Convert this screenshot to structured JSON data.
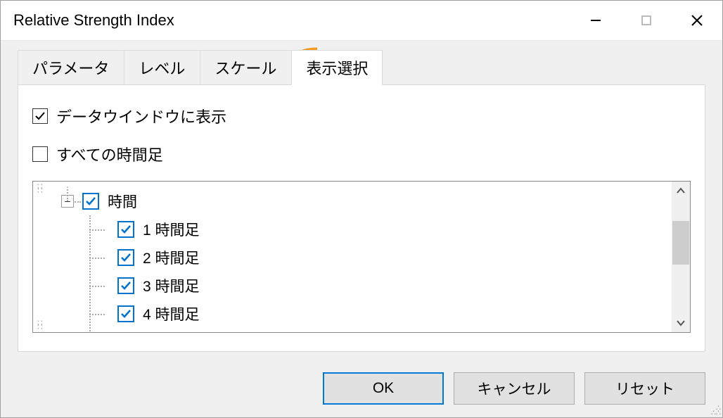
{
  "title": "Relative Strength Index",
  "tabs": [
    {
      "label": "パラメータ"
    },
    {
      "label": "レベル"
    },
    {
      "label": "スケール"
    },
    {
      "label": "表示選択"
    }
  ],
  "active_tab": 3,
  "options": {
    "show_in_data_window": {
      "label": "データウインドウに表示",
      "checked": true
    },
    "all_timeframes": {
      "label": "すべての時間足",
      "checked": false
    }
  },
  "tree": {
    "group_label": "時間",
    "group_checked": true,
    "items": [
      {
        "label": "1 時間足",
        "checked": true
      },
      {
        "label": "2 時間足",
        "checked": true
      },
      {
        "label": "3 時間足",
        "checked": true
      },
      {
        "label": "4 時間足",
        "checked": true
      }
    ]
  },
  "buttons": {
    "ok": "OK",
    "cancel": "キャンセル",
    "reset": "リセット"
  }
}
